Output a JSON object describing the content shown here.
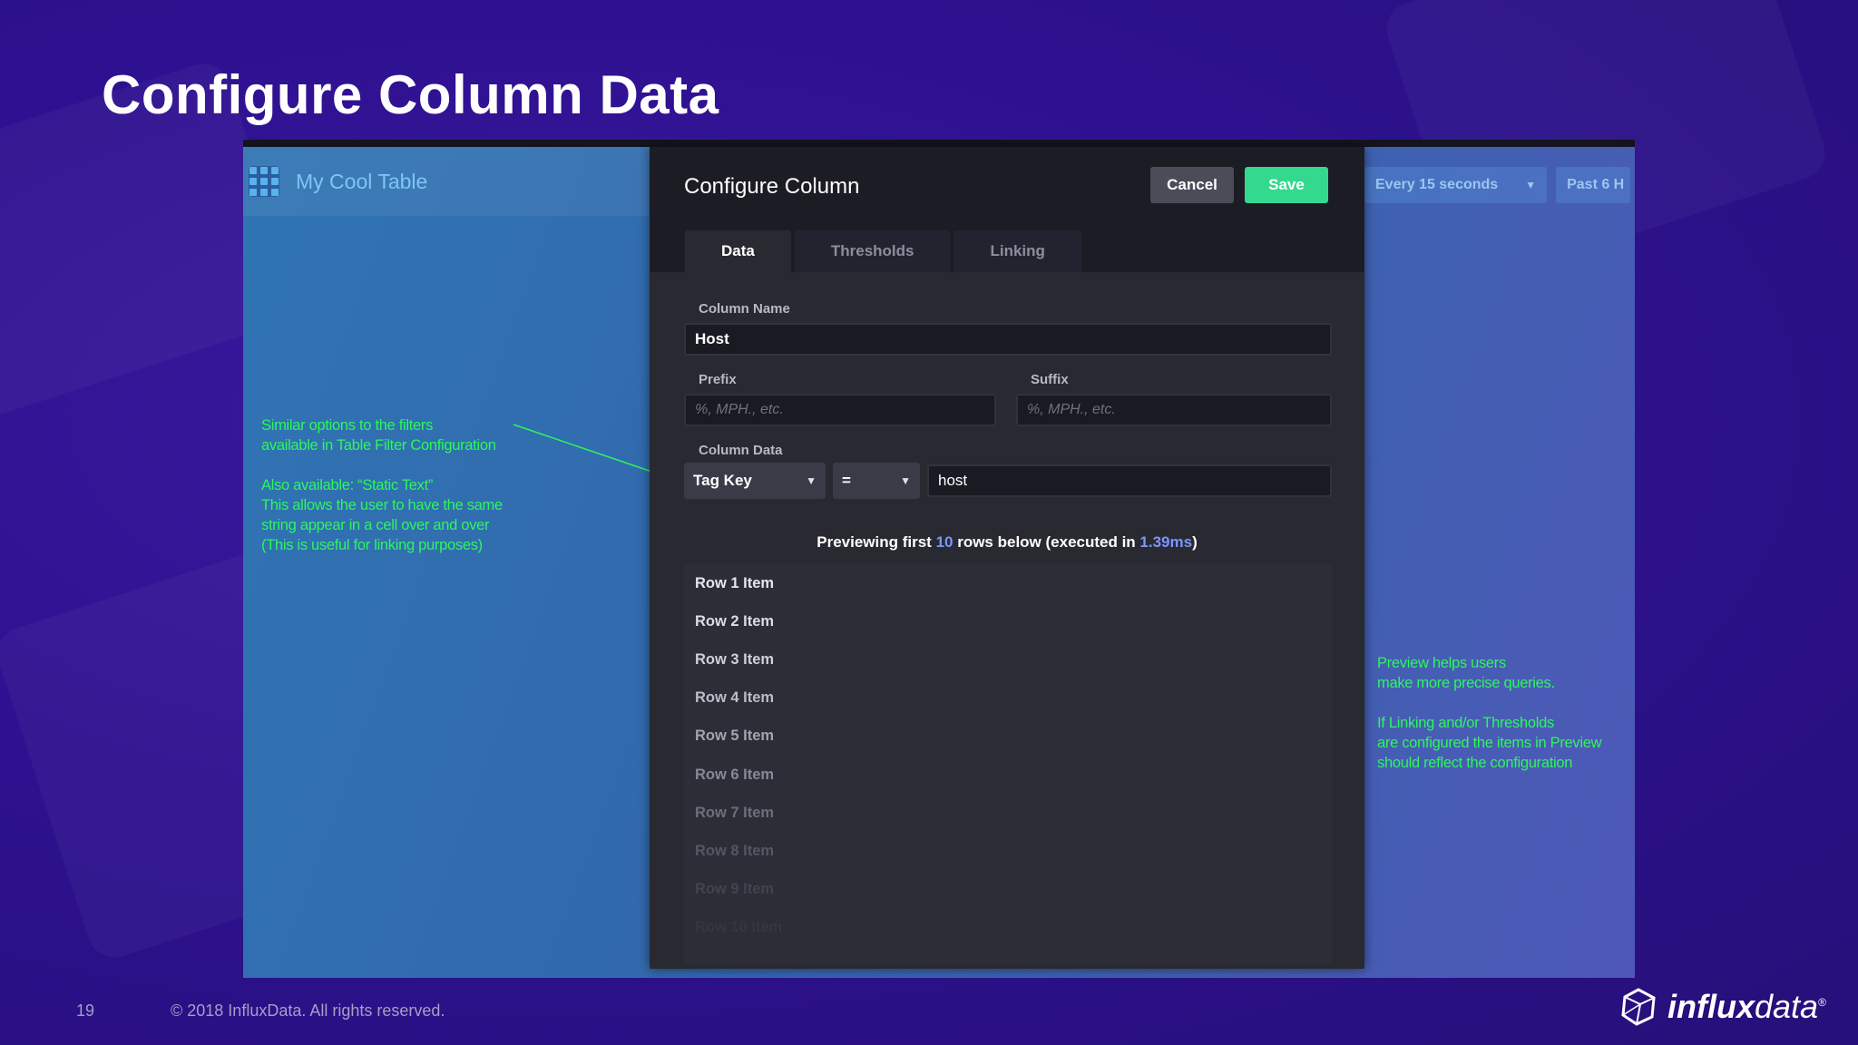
{
  "slide": {
    "title": "Configure Column Data",
    "page_number": "19",
    "copyright": "© 2018 InfluxData. All rights reserved.",
    "brand_bold": "influx",
    "brand_light": "data",
    "brand_mark": "®"
  },
  "app": {
    "table_name": "My Cool Table",
    "refresh_label": "Every 15 seconds",
    "time_range_label": "Past 6 H"
  },
  "modal": {
    "title": "Configure Column",
    "cancel_label": "Cancel",
    "save_label": "Save",
    "tabs": [
      {
        "label": "Data",
        "active": true
      },
      {
        "label": "Thresholds",
        "active": false
      },
      {
        "label": "Linking",
        "active": false
      }
    ],
    "column_name_label": "Column Name",
    "column_name_value": "Host",
    "prefix_label": "Prefix",
    "prefix_placeholder": "%, MPH., etc.",
    "suffix_label": "Suffix",
    "suffix_placeholder": "%, MPH., etc.",
    "column_data_label": "Column Data",
    "column_data_type": "Tag Key",
    "column_data_operator": "=",
    "column_data_value": "host",
    "preview": {
      "prefix": "Previewing first ",
      "count": "10",
      "middle": " rows below (executed in ",
      "time": "1.39ms",
      "suffix": ")"
    },
    "rows": [
      "Row 1 Item",
      "Row 2 Item",
      "Row 3 Item",
      "Row 4 Item",
      "Row 5 Item",
      "Row 6 Item",
      "Row 7 Item",
      "Row 8 Item",
      "Row 9 Item",
      "Row 10 Item"
    ]
  },
  "annotations": {
    "left": [
      "Similar options to the filters",
      "available in Table Filter Configuration",
      "Also available: “Static Text”",
      "This allows the user to have the same",
      "string appear in a cell over and over",
      "(This is useful for linking purposes)"
    ],
    "right": [
      "Preview helps users",
      "make more precise queries.",
      "If Linking and/or Thresholds",
      "are configured the items in Preview",
      "should reflect the configuration"
    ]
  },
  "colors": {
    "accent_green": "#2cf75a",
    "save_green": "#33d98e",
    "highlight_blue": "#7a96ff"
  }
}
